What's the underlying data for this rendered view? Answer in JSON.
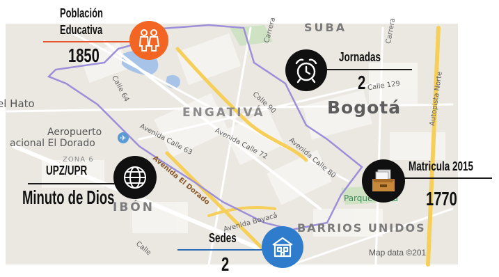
{
  "colors": {
    "accent_orange": "#f26522",
    "accent_blue": "#2e7ccb",
    "icon_dark": "#101010",
    "boundary": "#9c8ed8",
    "orange_line": "#e8532b",
    "blue_line": "#2d6bb3"
  },
  "map": {
    "district": "ENGATIVÁ",
    "city": "Bogotá",
    "north_area": "SUBA",
    "barrios": "BARRIOS UNIDOS",
    "bottom_area": "IBÓN",
    "hato": "el Hato",
    "airport_line1": "Aeropuerto",
    "airport_line2": "acional El Dorado",
    "zona": "ZONA 6",
    "park": "Parque de La",
    "credit": "Map data ©201",
    "streets": {
      "carrera_a": "Carrera",
      "carrera_b": "Carrera",
      "calle129": "Calle 129",
      "autopista": "Autopista Norte",
      "calle64": "Calle 64",
      "calle90": "Calle 90",
      "av_calle63": "Avenida Calle 63",
      "av_calle72": "Avenida Calle 72",
      "av_calle80": "Avenida Calle 80",
      "av_eldorado": "Avenida El Dorado",
      "av_boyaca": "Avenida Boyacá",
      "calle_bl": "Calle"
    }
  },
  "infographic": {
    "poblacion": {
      "label_line1": "Población",
      "label_line2": "Educativa",
      "value": "1850",
      "icon": "people-icon"
    },
    "jornadas": {
      "label": "Jornadas",
      "value": "2",
      "icon": "alarm-clock-icon"
    },
    "upz": {
      "label": "UPZ/UPR",
      "value": "Minuto de Dios",
      "icon": "globe-icon"
    },
    "matricula": {
      "label": "Matricula 2015",
      "value": "1770",
      "icon": "archive-box-icon"
    },
    "sedes": {
      "label": "Sedes",
      "value": "2",
      "icon": "building-icon"
    }
  }
}
